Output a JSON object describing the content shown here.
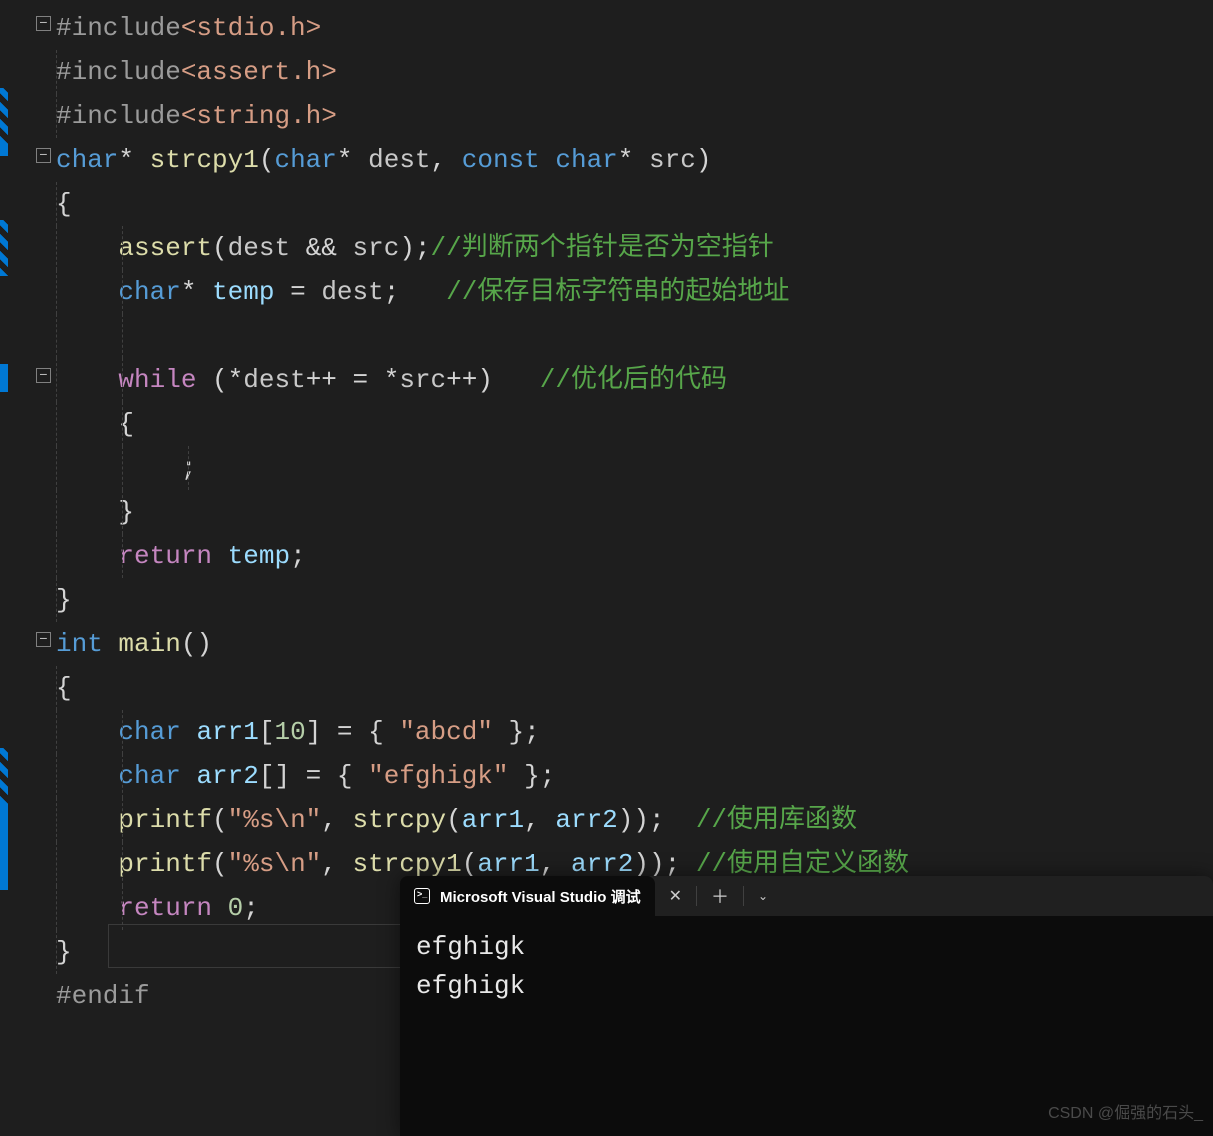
{
  "code": {
    "includes": [
      "#include",
      "#include",
      "#include"
    ],
    "headers": [
      "<stdio.h>",
      "<assert.h>",
      "<string.h>"
    ],
    "func1": {
      "ret": "char",
      "star": "*",
      "name": "strcpy1",
      "p1_type": "char",
      "p1_star": "*",
      "p1_name": "dest",
      "p2_const": "const",
      "p2_type": "char",
      "p2_star": "*",
      "p2_name": "src"
    },
    "assert_fn": "assert",
    "assert_arg1": "dest",
    "assert_op": "&&",
    "assert_arg2": "src",
    "comment1": "//判断两个指针是否为空指针",
    "temp_type": "char",
    "temp_star": "*",
    "temp_name": "temp",
    "temp_assign": "=",
    "temp_val": "dest",
    "comment2": "//保存目标字符串的起始地址",
    "while_kw": "while",
    "while_star1": "*",
    "while_d": "dest",
    "while_pp1": "++",
    "while_eq": "=",
    "while_star2": "*",
    "while_s": "src",
    "while_pp2": "++",
    "comment3": "//优化后的代码",
    "return_kw": "return",
    "return_val": "temp",
    "main_type": "int",
    "main_name": "main",
    "arr1_type": "char",
    "arr1_name": "arr1",
    "arr1_size": "10",
    "arr1_val": "\"abcd\"",
    "arr2_type": "char",
    "arr2_name": "arr2",
    "arr2_val": "\"efghigk\"",
    "printf": "printf",
    "fmt": "\"%s\\n\"",
    "strcpy": "strcpy",
    "strcpy1": "strcpy1",
    "a1": "arr1",
    "a2": "arr2",
    "comment4": "//使用库函数",
    "comment5": "//使用自定义函数",
    "ret0_kw": "return",
    "ret0_val": "0",
    "endif": "#endif"
  },
  "terminal": {
    "title": "Microsoft Visual Studio 调试",
    "output": [
      "efghigk",
      "efghigk"
    ]
  },
  "watermark": "CSDN @倔强的石头_"
}
